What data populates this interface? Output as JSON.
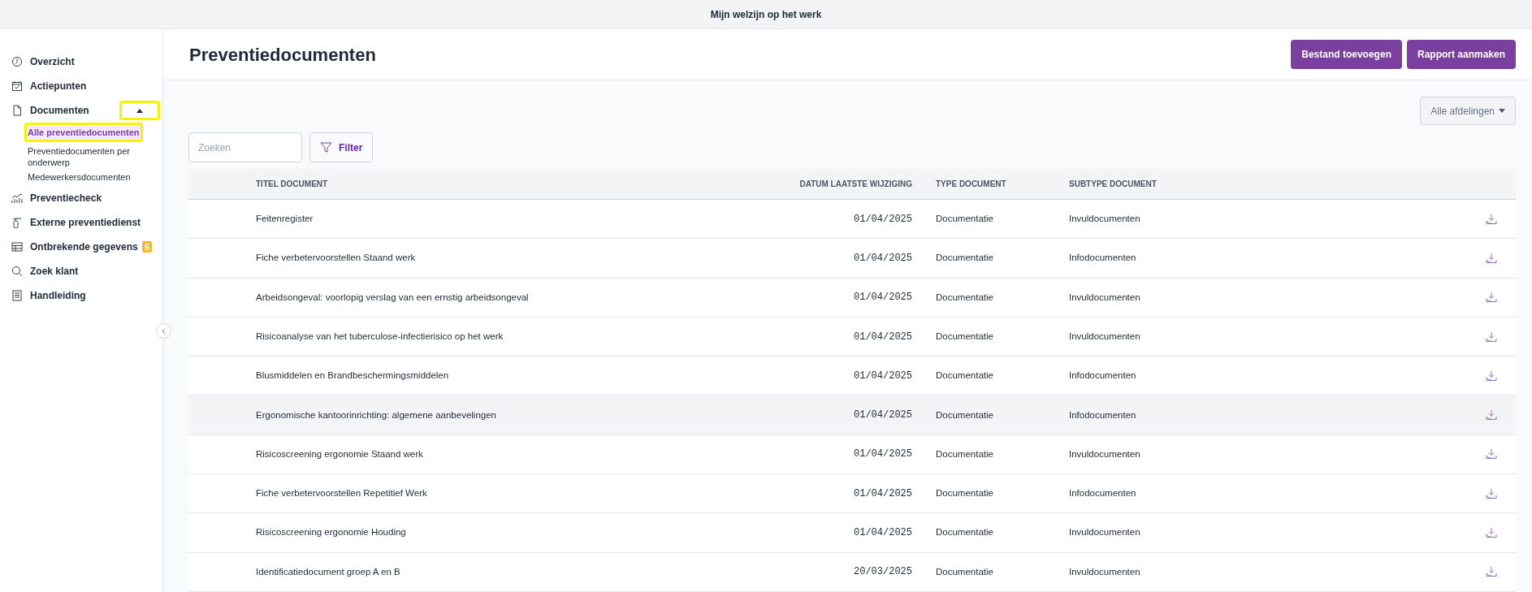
{
  "top_bar": {
    "title": "Mijn welzijn op het werk"
  },
  "sidebar": {
    "items": [
      {
        "label": "Overzicht",
        "selected": false
      },
      {
        "label": "Actiepunten",
        "selected": false
      },
      {
        "label": "Documenten",
        "selected": false,
        "expanded": true,
        "toggle_highlighted": true,
        "children": [
          {
            "label": "Alle preventiedocumenten",
            "selected": true,
            "highlighted": true
          },
          {
            "label": "Preventiedocumenten per onderwerp",
            "selected": false,
            "highlighted": false
          },
          {
            "label": "Medewerkersdocumenten",
            "selected": false,
            "highlighted": false
          }
        ]
      },
      {
        "label": "Preventiecheck",
        "selected": false
      },
      {
        "label": "Externe preventiedienst",
        "selected": false
      },
      {
        "label": "Ontbrekende gegevens",
        "selected": false,
        "badge": "5"
      },
      {
        "label": "Zoek klant",
        "selected": false
      },
      {
        "label": "Handleiding",
        "selected": false
      }
    ]
  },
  "header": {
    "title": "Preventiedocumenten",
    "buttons": [
      "Bestand toevoegen",
      "Rapport aanmaken"
    ]
  },
  "department_dropdown": {
    "value": "Alle afdelingen"
  },
  "search": {
    "placeholder": "Zoeken"
  },
  "filter_button": {
    "label": "Filter"
  },
  "table": {
    "columns": [
      "TITEL DOCUMENT",
      "DATUM LAATSTE WIJZIGING",
      "TYPE DOCUMENT",
      "SUBTYPE DOCUMENT"
    ],
    "rows": [
      {
        "title": "Feitenregister",
        "date": "01/04/2025",
        "type": "Documentatie",
        "subtype": "Invuldocumenten",
        "hovered": false
      },
      {
        "title": "Fiche verbetervoorstellen Staand werk",
        "date": "01/04/2025",
        "type": "Documentatie",
        "subtype": "Infodocumenten",
        "hovered": false
      },
      {
        "title": "Arbeidsongeval: voorlopig verslag van een ernstig arbeidsongeval",
        "date": "01/04/2025",
        "type": "Documentatie",
        "subtype": "Invuldocumenten",
        "hovered": false
      },
      {
        "title": "Risicoanalyse van het tuberculose-infectierisico op het werk",
        "date": "01/04/2025",
        "type": "Documentatie",
        "subtype": "Invuldocumenten",
        "hovered": false
      },
      {
        "title": "Blusmiddelen en Brandbeschermingsmiddelen",
        "date": "01/04/2025",
        "type": "Documentatie",
        "subtype": "Infodocumenten",
        "hovered": false
      },
      {
        "title": "Ergonomische kantoorinrichting: algemene aanbevelingen",
        "date": "01/04/2025",
        "type": "Documentatie",
        "subtype": "Infodocumenten",
        "hovered": true
      },
      {
        "title": "Risicoscreening ergonomie Staand werk",
        "date": "01/04/2025",
        "type": "Documentatie",
        "subtype": "Invuldocumenten",
        "hovered": false
      },
      {
        "title": "Fiche verbetervoorstellen Repetitief Werk",
        "date": "01/04/2025",
        "type": "Documentatie",
        "subtype": "Infodocumenten",
        "hovered": false
      },
      {
        "title": "Risicoscreening ergonomie Houding",
        "date": "01/04/2025",
        "type": "Documentatie",
        "subtype": "Invuldocumenten",
        "hovered": false
      },
      {
        "title": "Identificatiedocument groep A en B",
        "date": "20/03/2025",
        "type": "Documentatie",
        "subtype": "Invuldocumenten",
        "hovered": false
      }
    ]
  }
}
